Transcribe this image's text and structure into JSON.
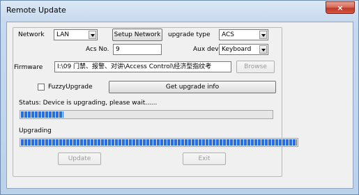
{
  "window": {
    "title": "Remote Update",
    "close_icon": "×"
  },
  "form": {
    "network_label": "Network",
    "network_value": "LAN",
    "setup_network_label": "Setup Network",
    "upgrade_type_label": "upgrade type",
    "upgrade_type_value": "ACS",
    "acs_no_label": "Acs No.",
    "acs_no_value": "9",
    "aux_dev_label": "Aux dev",
    "aux_dev_value": "Keyboard",
    "firmware_label": "Firmware",
    "firmware_path": "I:\\09 门禁、报警、对讲\\Access Control\\经济型指纹考",
    "browse_label": "Browse",
    "fuzzy_upgrade_label": "FuzzyUpgrade",
    "fuzzy_upgrade_checked": false,
    "get_upgrade_info_label": "Get upgrade info"
  },
  "status": {
    "text": "Status: Device is upgrading, please wait......",
    "status_progress": 0.17,
    "upgrading_label": "Upgrading",
    "upgrading_progress": 1.0
  },
  "actions": {
    "update_label": "Update",
    "exit_label": "Exit"
  },
  "colors": {
    "progress_fill": "#2a6fde",
    "close_button": "#c0392b"
  }
}
